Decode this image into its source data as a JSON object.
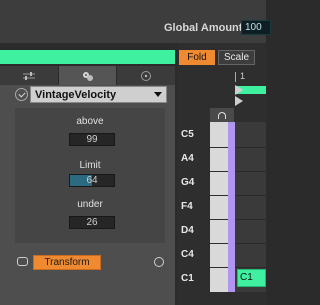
{
  "global": {
    "label": "Global Amount",
    "value": "100"
  },
  "device": {
    "tabs": [
      {
        "icon": "sliders-icon"
      },
      {
        "icon": "dice-icon"
      },
      {
        "icon": "scatter-icon"
      }
    ],
    "active_tab": 1,
    "preset": {
      "name": "VintageVelocity"
    },
    "params": [
      {
        "label": "above",
        "value": "99"
      },
      {
        "label": "Limit",
        "value": "64",
        "level": 0.5
      },
      {
        "label": "under",
        "value": "26"
      }
    ],
    "transform_label": "Transform"
  },
  "clip": {
    "fold_label": "Fold",
    "scale_label": "Scale",
    "ruler_bar": "1",
    "pitches": [
      "C5",
      "A4",
      "G4",
      "F4",
      "D4",
      "C4",
      "C1"
    ],
    "note": {
      "label": "C1"
    }
  },
  "colors": {
    "accent": "#3ef0a0",
    "orange": "#f08a30",
    "lilac": "#b096f0"
  }
}
